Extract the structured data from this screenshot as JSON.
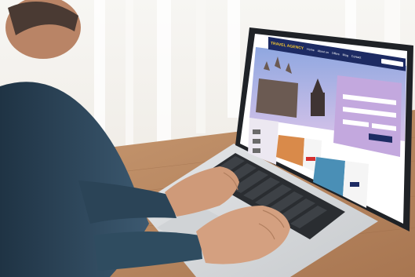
{
  "screen": {
    "logo": "TRAVEL AGENCY",
    "nav_items": [
      "Home",
      "About us",
      "Offers",
      "Blog",
      "Contact"
    ],
    "form_title": "",
    "offers_title": "",
    "deals_title": ""
  },
  "colors": {
    "wall": "#f3f1ec",
    "curtain": "#ffffff",
    "desk": "#b98a63",
    "laptop_body": "#d9dcdf",
    "screen_frame": "#1f2226",
    "nav": "#1d2b63",
    "screen_lilac": "#cbb5e3",
    "shirt": "#2f4658",
    "skin": "#cf9a79"
  }
}
